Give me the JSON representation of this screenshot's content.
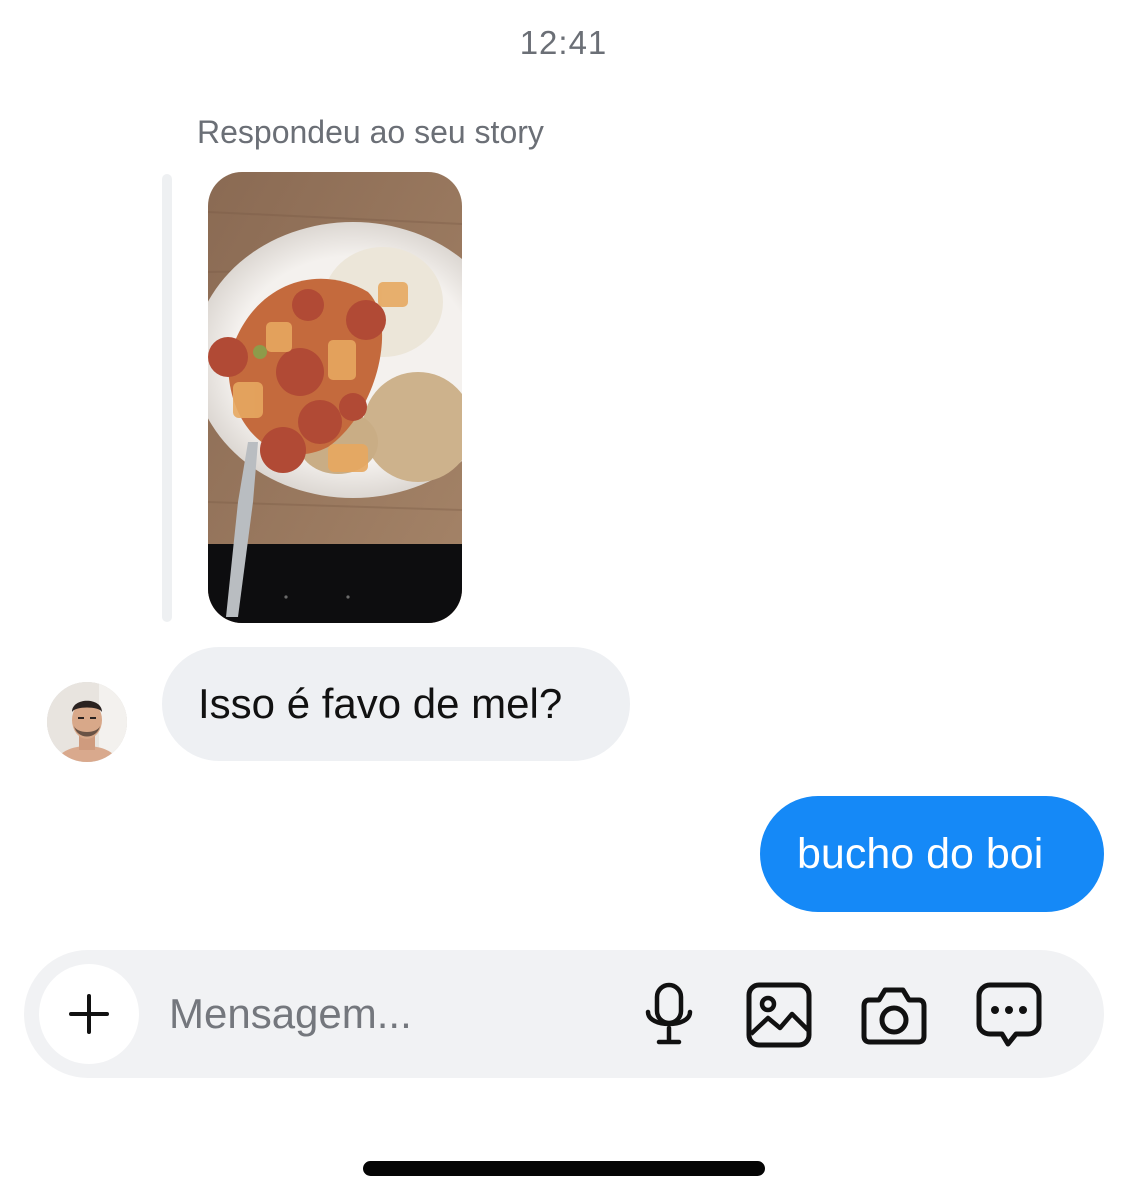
{
  "chat": {
    "timestamp": "12:41",
    "story_reply": {
      "caption": "Respondeu ao seu story"
    },
    "incoming_message": {
      "text": "Isso é favo de mel?"
    },
    "outgoing_message": {
      "text": "bucho do boi"
    }
  },
  "composer": {
    "placeholder": "Mensagem...",
    "icons": [
      "plus-icon",
      "microphone-icon",
      "gallery-icon",
      "camera-icon",
      "sticker-chat-icon"
    ]
  },
  "colors": {
    "outgoing_bubble": "#1589f7",
    "incoming_bubble": "#eef0f3",
    "muted_text": "#6b6f76"
  }
}
